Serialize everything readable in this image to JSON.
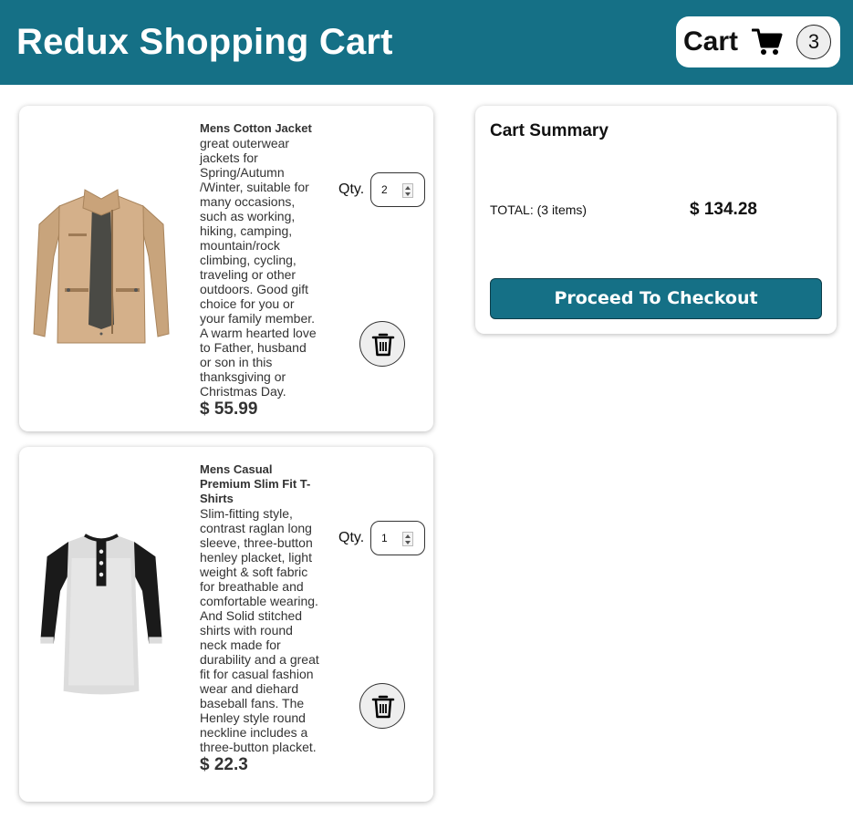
{
  "header": {
    "title": "Redux Shopping Cart",
    "cart_label": "Cart",
    "cart_count": "3",
    "cart_icon": "shopping-cart-icon"
  },
  "items": [
    {
      "name": "Mens Cotton Jacket",
      "description": "great outerwear jackets for Spring/Autumn /Winter, suitable for many occasions, such as working, hiking, camping, mountain/rock climbing, cycling, traveling or other outdoors. Good gift choice for you or your family member. A warm hearted love to Father, husband or son in this thanksgiving or Christmas Day.",
      "price": "$ 55.99",
      "qty_label": "Qty.",
      "qty_value": "2",
      "image": "jacket-image",
      "remove_icon": "trash-icon"
    },
    {
      "name": "Mens Casual Premium Slim Fit T-Shirts",
      "description": "Slim-fitting style, contrast raglan long sleeve, three-button henley placket, light weight & soft fabric for breathable and comfortable wearing. And Solid stitched shirts with round neck made for durability and a great fit for casual fashion wear and diehard baseball fans. The Henley style round neckline includes a three-button placket.",
      "price": "$ 22.3",
      "qty_label": "Qty.",
      "qty_value": "1",
      "image": "tshirt-image",
      "remove_icon": "trash-icon"
    }
  ],
  "summary": {
    "title": "Cart Summary",
    "total_label": "TOTAL: (3 items)",
    "total_value": "$ 134.28",
    "checkout_label": "Proceed To Checkout"
  },
  "colors": {
    "header_bg": "#157086",
    "button_bg": "#157086",
    "button_text": "#ffffff"
  }
}
